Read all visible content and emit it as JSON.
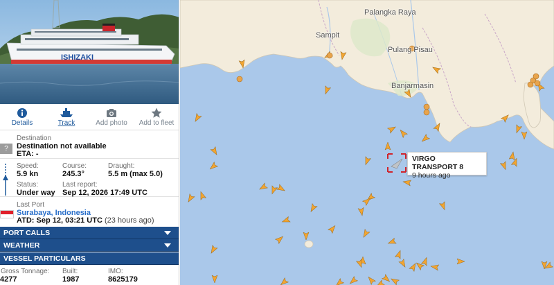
{
  "vessel_photo": {
    "hull_text": "ISHIZAKI"
  },
  "actions": [
    {
      "label": "Details",
      "icon": "info-icon",
      "active": false
    },
    {
      "label": "Track",
      "icon": "ship-icon",
      "active": true
    },
    {
      "label": "Add photo",
      "icon": "camera-icon",
      "active": false
    },
    {
      "label": "Add to fleet",
      "icon": "star-icon",
      "active": false
    }
  ],
  "destination": {
    "label": "Destination",
    "value": "Destination not available",
    "eta": "ETA: -",
    "icon_text": "?"
  },
  "speed": {
    "label": "Speed:",
    "value": "5.9 kn"
  },
  "course": {
    "label": "Course:",
    "value": "245.3°"
  },
  "draught": {
    "label": "Draught:",
    "value": "5.5 m (max 5.0)"
  },
  "status": {
    "label": "Status:",
    "value": "Under way"
  },
  "last_report": {
    "label": "Last report:",
    "value": "Sep 12, 2026 17:49 UTC"
  },
  "last_port": {
    "label": "Last Port",
    "port": "Surabaya, Indonesia",
    "atd": "ATD: Sep 12, 03:21 UTC",
    "atd_ago": "(23 hours ago)"
  },
  "bars": {
    "port_calls": "PORT CALLS",
    "weather": "WEATHER",
    "vessel_particulars": "VESSEL PARTICULARS"
  },
  "particulars": {
    "gross_tonnage_label": "Gross Tonnage:",
    "gross_tonnage": "4277",
    "built_label": "Built:",
    "built": "1987",
    "imo_label": "IMO:",
    "imo": "8625179"
  },
  "map": {
    "cities": [
      "Palangka Raya",
      "Sampit",
      "Pulang Pisau",
      "Banjarmasin"
    ],
    "selected_vessel": {
      "name": "VIRGO TRANSPORT 8",
      "time_ago": "9 hours ago"
    },
    "colors": {
      "sea": "#aac8ea",
      "land": "#f3ecdc",
      "vessel": "#f2a531",
      "selected": "#c0c4c8",
      "port": "#e8a44c"
    }
  }
}
